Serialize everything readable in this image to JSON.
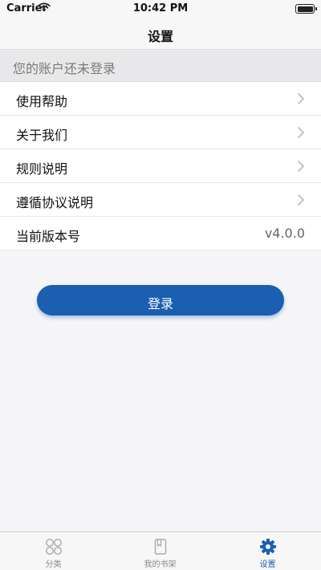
{
  "status_bar": {
    "carrier": "Carrier",
    "time": "10:42 PM",
    "icons": [
      "wifi-icon",
      "battery-icon"
    ]
  },
  "nav": {
    "title": "设置"
  },
  "account": {
    "notice": "您的账户还未登录"
  },
  "settings": {
    "items": [
      {
        "label": "使用帮助",
        "icon": "chevron-right-icon"
      },
      {
        "label": "关于我们",
        "icon": "chevron-right-icon"
      },
      {
        "label": "规则说明",
        "icon": "chevron-right-icon"
      },
      {
        "label": "遵循协议说明",
        "icon": "chevron-right-icon"
      }
    ],
    "version": {
      "label": "当前版本号",
      "value": "v4.0.0"
    }
  },
  "login": {
    "label": "登录"
  },
  "tab_bar": {
    "tabs": [
      {
        "label": "分类",
        "icon": "category-grid-icon",
        "active": false
      },
      {
        "label": "我的书架",
        "icon": "bookshelf-icon",
        "active": false
      },
      {
        "label": "设置",
        "icon": "gear-icon",
        "active": true
      }
    ]
  },
  "colors": {
    "accent": "#1a5fb0",
    "inactive_tab": "#888888",
    "banner_bg": "#e8e8ea",
    "page_bg": "#f5f5f7"
  }
}
